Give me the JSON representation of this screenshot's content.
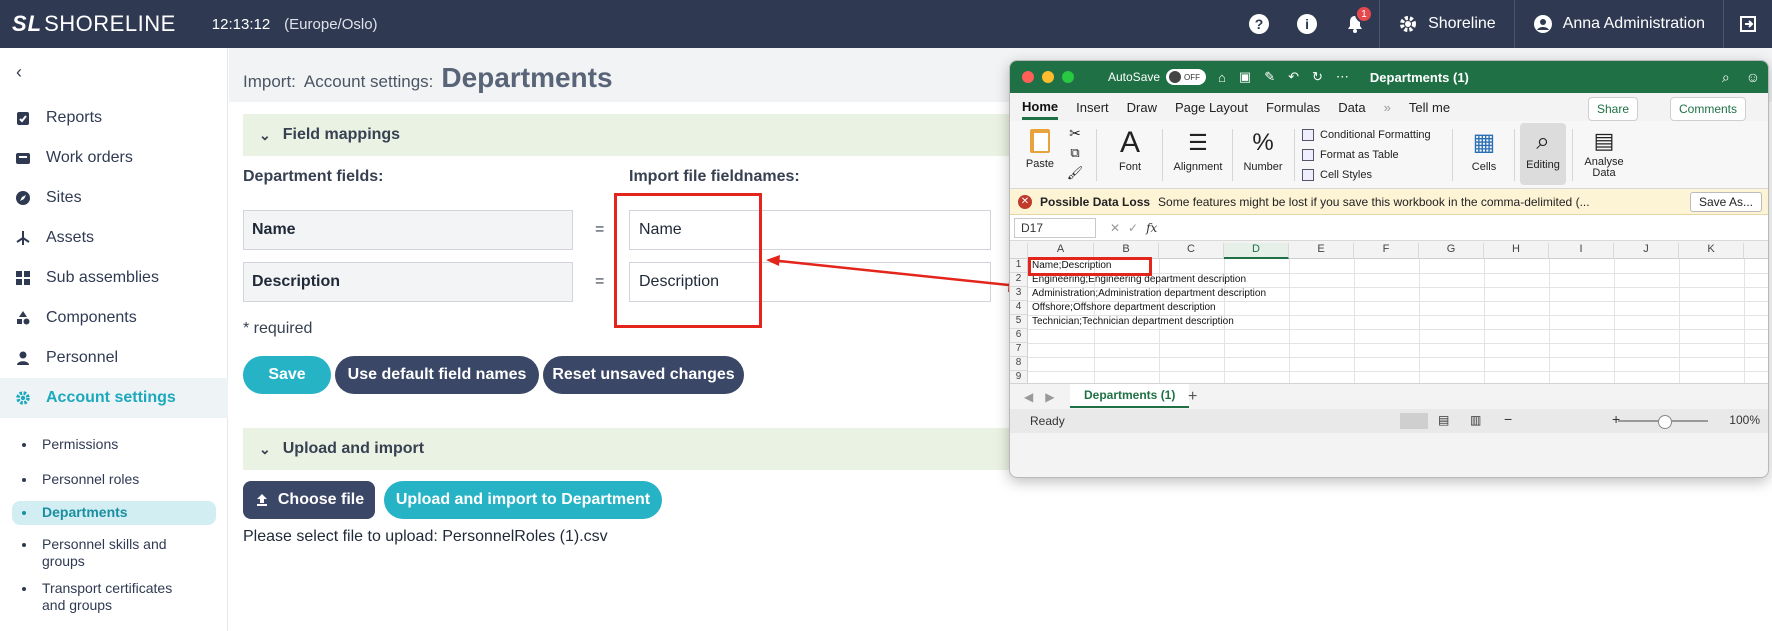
{
  "topbar": {
    "logo_mark": "SL",
    "logo_word": "SHORELINE",
    "clock": "12:13:12",
    "timezone": "(Europe/Oslo)",
    "notification_count": "1",
    "org_label": "Shoreline",
    "user_label": "Anna Administration"
  },
  "sidebar": {
    "items": [
      {
        "label": "Reports",
        "icon": "clipboard-check-icon"
      },
      {
        "label": "Work orders",
        "icon": "tray-icon"
      },
      {
        "label": "Sites",
        "icon": "compass-icon"
      },
      {
        "label": "Assets",
        "icon": "antenna-icon"
      },
      {
        "label": "Sub assemblies",
        "icon": "grid-icon"
      },
      {
        "label": "Components",
        "icon": "shapes-icon"
      },
      {
        "label": "Personnel",
        "icon": "person-icon"
      },
      {
        "label": "Account settings",
        "icon": "gear-icon"
      }
    ],
    "sub_items": [
      {
        "label": "Permissions"
      },
      {
        "label": "Personnel roles"
      },
      {
        "label": "Departments"
      },
      {
        "label": "Personnel skills and groups"
      },
      {
        "label": "Transport certificates and groups"
      }
    ]
  },
  "breadcrumb": {
    "crumb1": "Import:",
    "crumb2": "Account settings:",
    "title": "Departments"
  },
  "mappings": {
    "section_title": "Field mappings",
    "left_header": "Department fields:",
    "right_header": "Import file fieldnames:",
    "rows": [
      {
        "field": "Name",
        "eq": "=",
        "value": "Name"
      },
      {
        "field": "Description",
        "eq": "=",
        "value": "Description"
      }
    ],
    "required_note": "* required",
    "save_label": "Save",
    "default_label": "Use default field names",
    "reset_label": "Reset unsaved changes"
  },
  "upload": {
    "section_title": "Upload and import",
    "choose_label": "Choose file",
    "import_label": "Upload and import to Department",
    "note": "Please select file to upload: PersonnelRoles (1).csv"
  },
  "excel": {
    "autosave": "AutoSave",
    "toggle": "OFF",
    "doc_title": "Departments (1)",
    "tabs": [
      "Home",
      "Insert",
      "Draw",
      "Page Layout",
      "Formulas",
      "Data",
      "Tell me"
    ],
    "share": "Share",
    "comments": "Comments",
    "ribbon": {
      "paste": "Paste",
      "font": "Font",
      "alignment": "Alignment",
      "number": "Number",
      "cond_format": "Conditional Formatting",
      "format_table": "Format as Table",
      "cell_styles": "Cell Styles",
      "cells": "Cells",
      "editing": "Editing",
      "analyse": "Analyse Data"
    },
    "warning_title": "Possible Data Loss",
    "warning_text": "Some features might be lost if you save this workbook in the comma-delimited (...",
    "save_as": "Save As...",
    "name_box": "D17",
    "columns": [
      "A",
      "B",
      "C",
      "D",
      "E",
      "F",
      "G",
      "H",
      "I",
      "J",
      "K"
    ],
    "rows": [
      "1",
      "2",
      "3",
      "4",
      "5",
      "6",
      "7",
      "8",
      "9"
    ],
    "cells": [
      "Name;Description",
      "Engineering;Engineering department description",
      "Administration;Administration department description",
      "Offshore;Offshore department description",
      "Technician;Technician department description"
    ],
    "sheet_tab": "Departments (1)",
    "status": "Ready",
    "zoom": "100%"
  },
  "colors": {
    "topbar": "#2f3a52",
    "accent": "#26b3c6",
    "dark_button": "#3b4766",
    "section_bg": "#eaf2e3",
    "highlight_red": "#e3251b",
    "excel_green": "#1f7145"
  }
}
